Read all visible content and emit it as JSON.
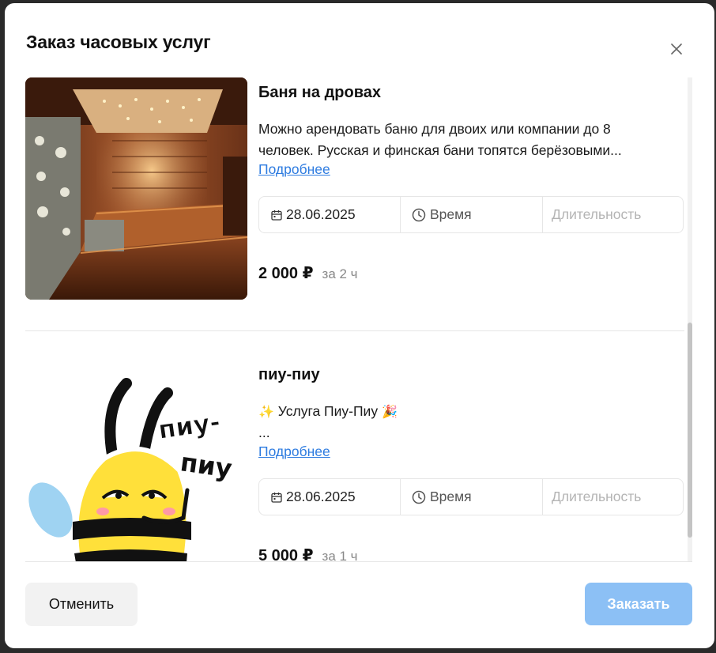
{
  "modal": {
    "title": "Заказ часовых услуг"
  },
  "services": [
    {
      "title": "Баня на дровах",
      "description": "Можно арендовать баню для двоих или компании до 8 человек. Русская и финская бани топятся берёзовыми...",
      "more_label": "Подробнее",
      "date": "28.06.2025",
      "time_placeholder": "Время",
      "duration_placeholder": "Длительность",
      "price": "2 000 ₽",
      "price_unit": "за 2 ч",
      "image_icon": "sauna-photo"
    },
    {
      "title": "пиу-пиу",
      "desc_emoji_left": "✨",
      "desc_text": "Услуга Пиу-Пиу",
      "desc_emoji_right": "🎉",
      "desc_line2": "...",
      "more_label": "Подробнее",
      "date": "28.06.2025",
      "time_placeholder": "Время",
      "duration_placeholder": "Длительность",
      "price": "5 000 ₽",
      "price_unit": "за 1 ч",
      "image_icon": "bee-sticker",
      "sticker_text_line1": "пиу-",
      "sticker_text_line2": "пиу"
    }
  ],
  "footer": {
    "cancel_label": "Отменить",
    "order_label": "Заказать"
  },
  "colors": {
    "accent": "#2d7be0",
    "order_button": "#8cc0f5"
  }
}
